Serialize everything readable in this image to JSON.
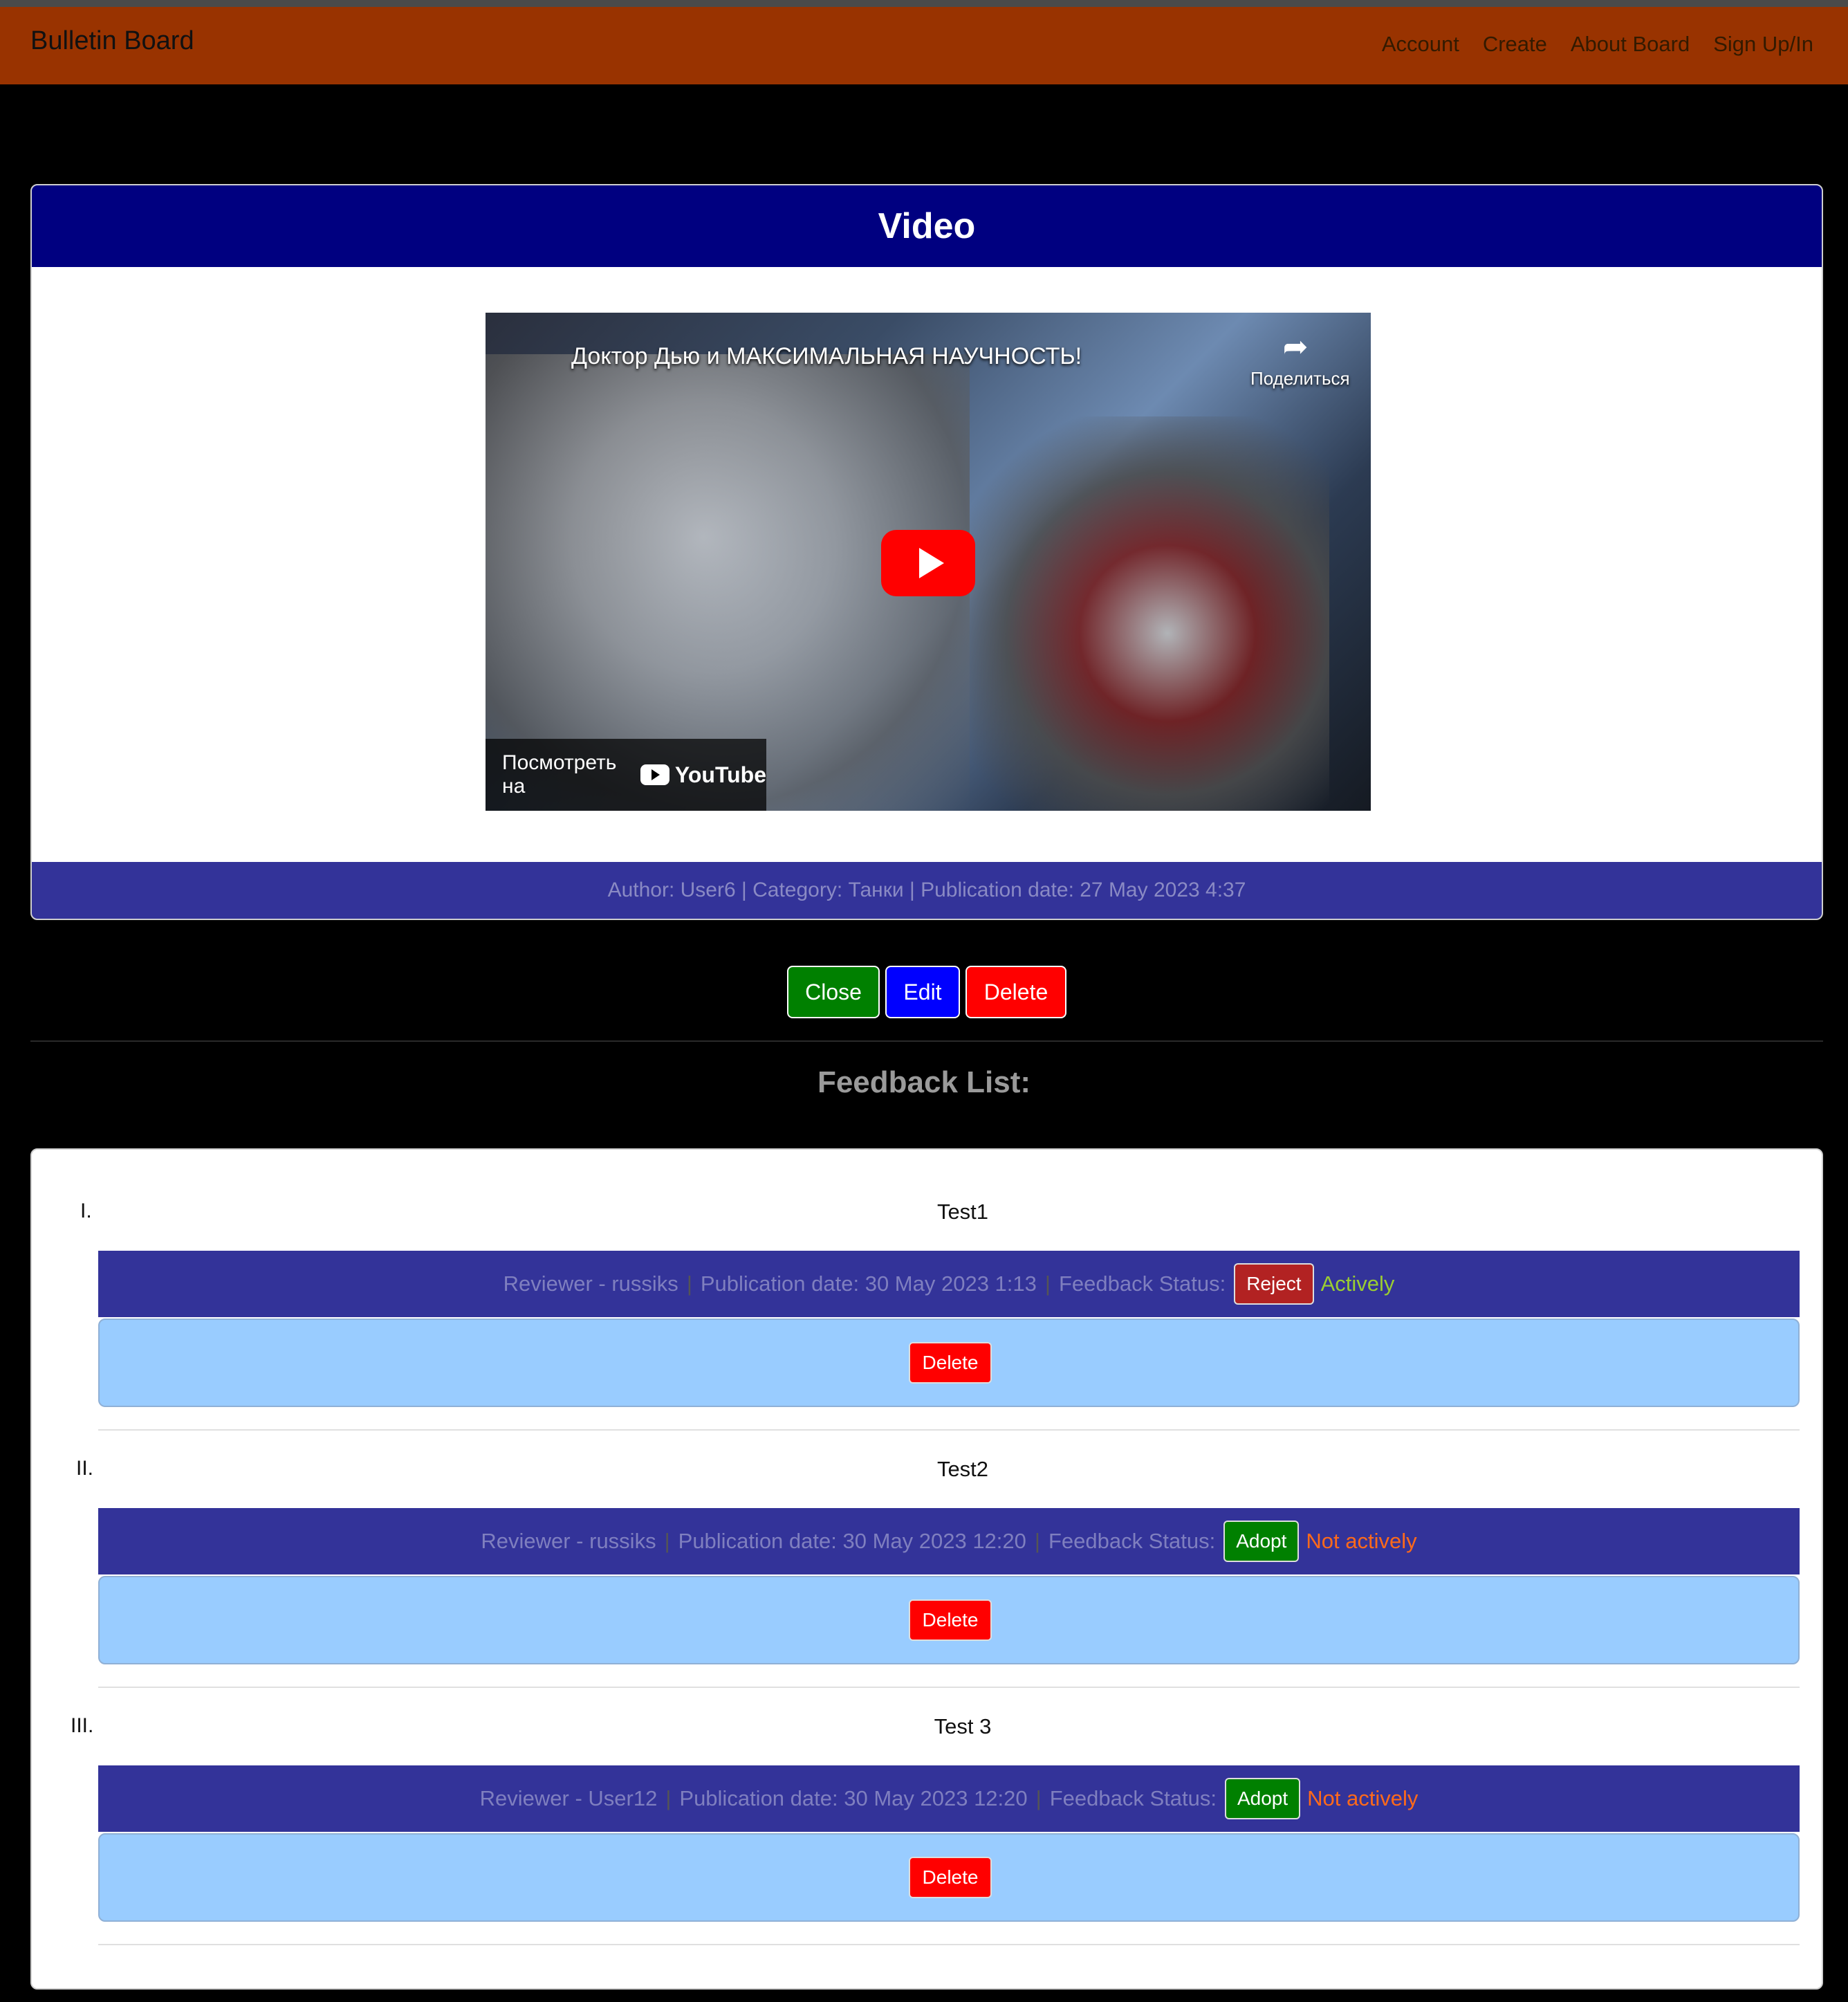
{
  "navbar": {
    "brand": "Bulletin Board",
    "links": [
      "Account",
      "Create",
      "About Board",
      "Sign Up/In"
    ]
  },
  "post": {
    "header": "Video",
    "video": {
      "title": "Доктор Дью и МАКСИМАЛЬНАЯ НАУЧНОСТЬ!",
      "share_label": "Поделиться",
      "watch_label": "Посмотреть на",
      "youtube_label": "YouTube"
    },
    "footer": "Author: User6 | Category: Танки | Publication date: 27 May 2023 4:37"
  },
  "actions": {
    "close": "Close",
    "edit": "Edit",
    "delete": "Delete"
  },
  "feedback": {
    "title": "Feedback List:",
    "status_label": "Feedback Status:",
    "delete_label": "Delete",
    "items": [
      {
        "numeral": "I.",
        "title": "Test1",
        "reviewer": "Reviewer - russiks",
        "date": "Publication date: 30 May 2023 1:13",
        "action": "Reject",
        "status": "Actively"
      },
      {
        "numeral": "II.",
        "title": "Test2",
        "reviewer": "Reviewer - russiks",
        "date": "Publication date: 30 May 2023 12:20",
        "action": "Adopt",
        "status": "Not actively"
      },
      {
        "numeral": "III.",
        "title": "Test 3",
        "reviewer": "Reviewer - User12",
        "date": "Publication date: 30 May 2023 12:20",
        "action": "Adopt",
        "status": "Not actively"
      }
    ]
  },
  "colors": {
    "navbar": "#993300",
    "header": "#000080",
    "footer": "#333399",
    "feedback_body": "#99ccff",
    "active": "#9acd32",
    "inactive": "#ff6a1a"
  }
}
